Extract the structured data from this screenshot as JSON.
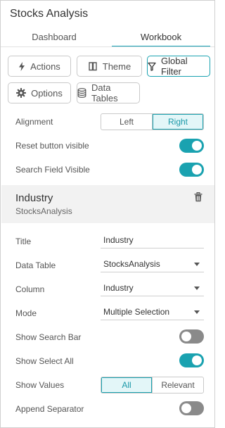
{
  "panel": {
    "title": "Stocks Analysis"
  },
  "tabs": [
    {
      "label": "Dashboard",
      "active": false
    },
    {
      "label": "Workbook",
      "active": true
    }
  ],
  "toolbar": {
    "actions": {
      "label": "Actions",
      "icon": "lightning-icon"
    },
    "theme": {
      "label": "Theme",
      "icon": "book-icon"
    },
    "global_filter": {
      "label": "Global Filter",
      "icon": "filter-icon",
      "active": true
    },
    "options": {
      "label": "Options",
      "icon": "gear-icon"
    },
    "data_tables": {
      "label": "Data Tables",
      "icon": "database-icon"
    }
  },
  "settings": {
    "alignment": {
      "label": "Alignment",
      "options": [
        "Left",
        "Right"
      ],
      "selected": "Right"
    },
    "reset_button_visible": {
      "label": "Reset button visible",
      "on": true
    },
    "search_field_visible": {
      "label": "Search Field Visible",
      "on": true
    }
  },
  "filter": {
    "name": "Industry",
    "source": "StocksAnalysis",
    "delete_icon": "trash-icon",
    "title": {
      "label": "Title",
      "value": "Industry"
    },
    "data_table": {
      "label": "Data Table",
      "value": "StocksAnalysis"
    },
    "column": {
      "label": "Column",
      "value": "Industry"
    },
    "mode": {
      "label": "Mode",
      "value": "Multiple Selection"
    },
    "show_search_bar": {
      "label": "Show Search Bar",
      "on": false
    },
    "show_select_all": {
      "label": "Show Select All",
      "on": true
    },
    "show_values": {
      "label": "Show Values",
      "options": [
        "All",
        "Relevant"
      ],
      "selected": "All"
    },
    "append_separator": {
      "label": "Append Separator",
      "on": false
    }
  },
  "colors": {
    "accent": "#1aa2b0",
    "toggle_off": "#8a8a8a",
    "section_bg": "#f2f2f2"
  }
}
